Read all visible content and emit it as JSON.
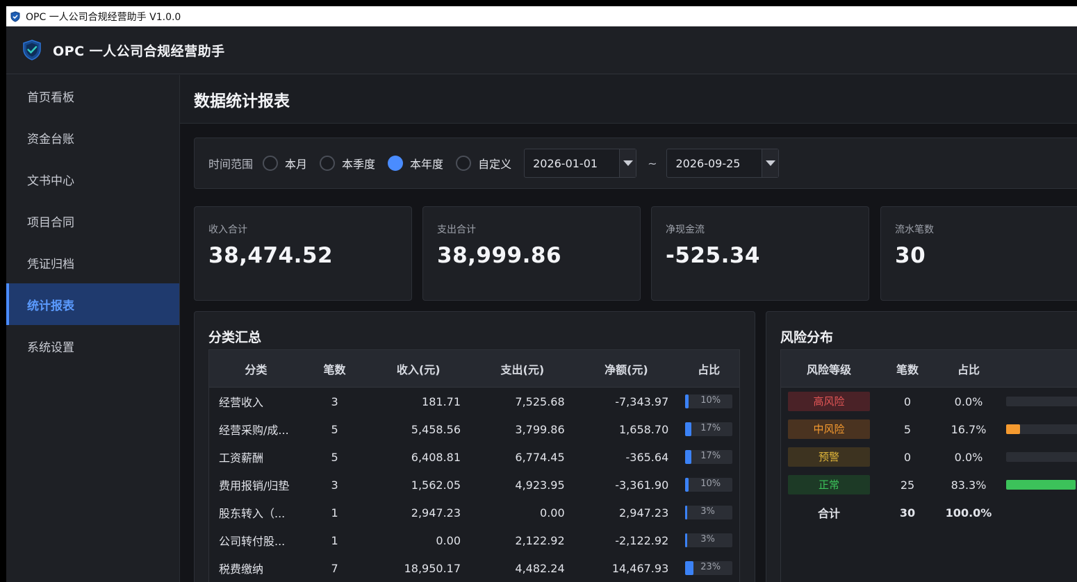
{
  "window": {
    "title": "OPC 一人公司合规经营助手 V1.0.0"
  },
  "header": {
    "app_name": "OPC 一人公司合规经营助手"
  },
  "sidebar": {
    "items": [
      {
        "label": "首页看板"
      },
      {
        "label": "资金台账"
      },
      {
        "label": "文书中心"
      },
      {
        "label": "项目合同"
      },
      {
        "label": "凭证归档"
      },
      {
        "label": "统计报表",
        "active": true
      },
      {
        "label": "系统设置"
      }
    ]
  },
  "page": {
    "title": "数据统计报表"
  },
  "filter": {
    "label": "时间范围",
    "options": [
      "本月",
      "本季度",
      "本年度",
      "自定义"
    ],
    "selected": "本年度",
    "date_from": "2026-01-01",
    "separator": "~",
    "date_to": "2026-09-25"
  },
  "summary": [
    {
      "label": "收入合计",
      "value": "38,474.52"
    },
    {
      "label": "支出合计",
      "value": "38,999.86"
    },
    {
      "label": "净现金流",
      "value": "-525.34"
    },
    {
      "label": "流水笔数",
      "value": "30"
    }
  ],
  "category_panel": {
    "title": "分类汇总",
    "columns": [
      "分类",
      "笔数",
      "收入(元)",
      "支出(元)",
      "净额(元)",
      "占比"
    ],
    "rows": [
      {
        "name": "经营收入",
        "count": "3",
        "income": "181.71",
        "expense": "7,525.68",
        "net": "-7,343.97",
        "ratio_label": "10%",
        "ratio": 0.1
      },
      {
        "name": "经营采购/成...",
        "count": "5",
        "income": "5,458.56",
        "expense": "3,799.86",
        "net": "1,658.70",
        "ratio_label": "17%",
        "ratio": 0.17
      },
      {
        "name": "工资薪酬",
        "count": "5",
        "income": "6,408.81",
        "expense": "6,774.45",
        "net": "-365.64",
        "ratio_label": "17%",
        "ratio": 0.17
      },
      {
        "name": "费用报销/归垫",
        "count": "3",
        "income": "1,562.05",
        "expense": "4,923.95",
        "net": "-3,361.90",
        "ratio_label": "10%",
        "ratio": 0.1
      },
      {
        "name": "股东转入（...",
        "count": "1",
        "income": "2,947.23",
        "expense": "0.00",
        "net": "2,947.23",
        "ratio_label": "3%",
        "ratio": 0.03
      },
      {
        "name": "公司转付股...",
        "count": "1",
        "income": "0.00",
        "expense": "2,122.92",
        "net": "-2,122.92",
        "ratio_label": "3%",
        "ratio": 0.03
      },
      {
        "name": "税费缴纳",
        "count": "7",
        "income": "18,950.17",
        "expense": "4,482.24",
        "net": "14,467.93",
        "ratio_label": "23%",
        "ratio": 0.23
      }
    ]
  },
  "risk_panel": {
    "title": "风险分布",
    "columns": [
      "风险等级",
      "笔数",
      "占比"
    ],
    "rows": [
      {
        "level": "高风险",
        "count": "0",
        "pct": "0.0%",
        "ratio": 0.0,
        "text_color": "#e05555",
        "bg_color": "#4a2227",
        "bar_color": "#e05555"
      },
      {
        "level": "中风险",
        "count": "5",
        "pct": "16.7%",
        "ratio": 0.167,
        "text_color": "#f59a2f",
        "bg_color": "#4a3320",
        "bar_color": "#f59a2f"
      },
      {
        "level": "预警",
        "count": "0",
        "pct": "0.0%",
        "ratio": 0.0,
        "text_color": "#e0b63a",
        "bg_color": "#3d3320",
        "bar_color": "#e0b63a"
      },
      {
        "level": "正常",
        "count": "25",
        "pct": "83.3%",
        "ratio": 0.833,
        "text_color": "#3cc25a",
        "bg_color": "#1d3a26",
        "bar_color": "#3cc25a"
      }
    ],
    "total": {
      "label": "合计",
      "count": "30",
      "pct": "100.0%"
    }
  },
  "colors": {
    "accent": "#4a8cff",
    "ratio_fill": "#3b82f6"
  }
}
